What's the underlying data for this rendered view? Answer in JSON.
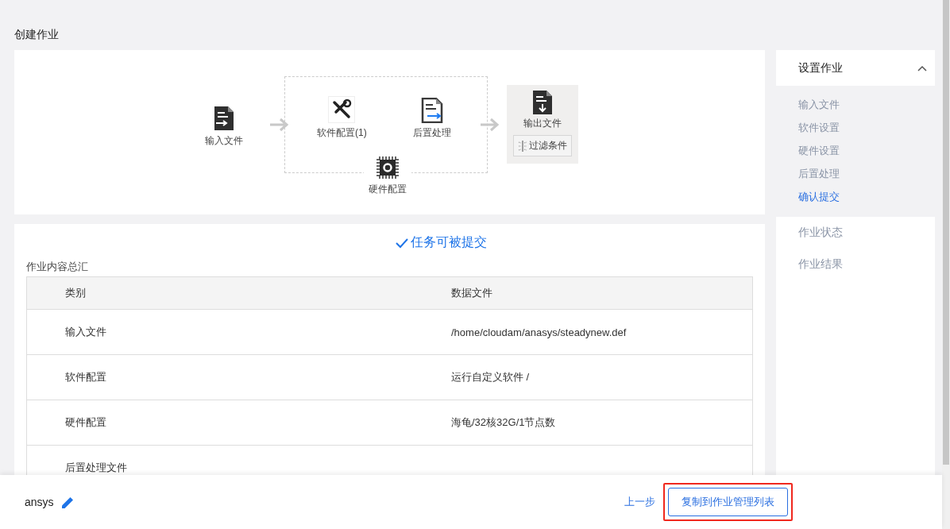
{
  "page_title": "创建作业",
  "flow": {
    "input": {
      "label": "输入文件"
    },
    "software": {
      "label": "软件配置(1)"
    },
    "post": {
      "label": "后置处理"
    },
    "hardware": {
      "label": "硬件配置"
    },
    "output": {
      "label": "输出文件",
      "filter_button": "过滤条件"
    }
  },
  "status_message": "任务可被提交",
  "summary": {
    "title": "作业内容总汇",
    "columns": [
      "类别",
      "数据文件"
    ],
    "rows": [
      {
        "category": "输入文件",
        "data": "/home/cloudam/anasys/steadynew.def"
      },
      {
        "category": "软件配置",
        "data": "运行自定义软件 /"
      },
      {
        "category": "硬件配置",
        "data": "海龟/32核32G/1节点数"
      },
      {
        "category": "后置处理文件"
      }
    ]
  },
  "sidebar": {
    "sections": [
      {
        "label": "设置作业",
        "expanded": true,
        "children": [
          {
            "label": "输入文件",
            "selected": false
          },
          {
            "label": "软件设置",
            "selected": false
          },
          {
            "label": "硬件设置",
            "selected": false
          },
          {
            "label": "后置处理",
            "selected": false
          },
          {
            "label": "确认提交",
            "selected": true
          }
        ]
      },
      {
        "label": "作业状态"
      },
      {
        "label": "作业结果"
      }
    ]
  },
  "footer": {
    "job_name": "ansys",
    "back_link": "上一步",
    "primary_button": {
      "label": "复制到作业管理列表",
      "highlighted": true
    }
  }
}
